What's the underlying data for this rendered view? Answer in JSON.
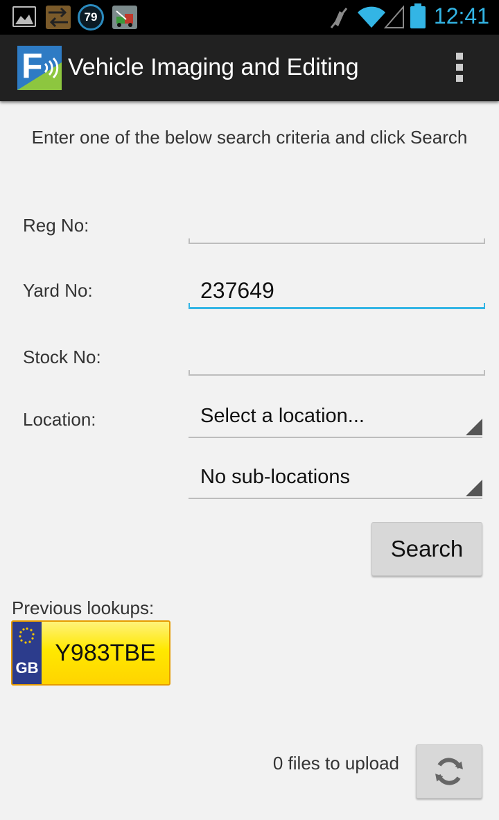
{
  "status_bar": {
    "time": "12:41",
    "notification_badge": "79",
    "icons": [
      "gallery-icon",
      "usb-icon",
      "badge-79-icon",
      "tow-truck-icon",
      "mute-icon",
      "wifi-icon",
      "signal-icon",
      "battery-icon"
    ],
    "accent_color": "#33b5e5"
  },
  "action_bar": {
    "logo_letter": "F",
    "title": "Vehicle Imaging and Editing",
    "overflow_icon": "overflow-menu-icon"
  },
  "form": {
    "instructions": "Enter one of the below search criteria and click Search",
    "reg_label": "Reg No:",
    "reg_value": "",
    "yard_label": "Yard No:",
    "yard_value": "237649",
    "stock_label": "Stock No:",
    "stock_value": "",
    "location_label": "Location:",
    "location_selected": "Select a location...",
    "sublocation_selected": "No sub-locations",
    "search_button": "Search"
  },
  "previous": {
    "label": "Previous lookups:",
    "plates": [
      {
        "country": "GB",
        "reg": "Y983TBE"
      }
    ]
  },
  "upload": {
    "status": "0 files to upload",
    "sync_icon": "sync-icon"
  }
}
